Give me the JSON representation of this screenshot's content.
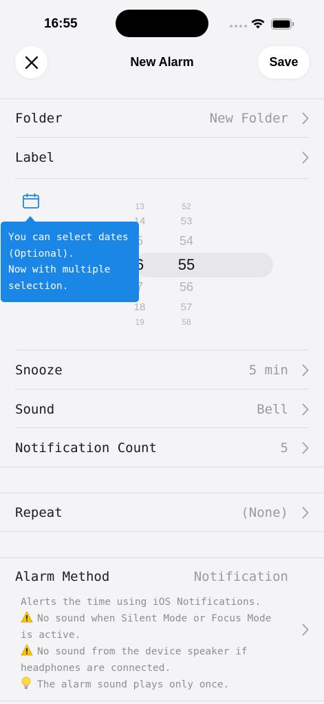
{
  "status_bar": {
    "time": "16:55"
  },
  "nav": {
    "title": "New Alarm",
    "save_label": "Save",
    "close_icon": "close-icon"
  },
  "rows": {
    "folder": {
      "label": "Folder",
      "value": "New Folder"
    },
    "label": {
      "label": "Label"
    },
    "snooze": {
      "label": "Snooze",
      "value": "5 min"
    },
    "sound": {
      "label": "Sound",
      "value": "Bell"
    },
    "notification_count": {
      "label": "Notification Count",
      "value": "5"
    },
    "repeat": {
      "label": "Repeat",
      "value": "(None)"
    }
  },
  "picker": {
    "hours": [
      "13",
      "14",
      "5",
      "6",
      "7",
      "18",
      "19"
    ],
    "minutes": [
      "52",
      "53",
      "54",
      "55",
      "56",
      "57",
      "58"
    ],
    "selected_hour": "6",
    "selected_minute": "55"
  },
  "tooltip": {
    "lines": [
      "You can select dates",
      "(Optional).",
      "Now with multiple",
      "selection."
    ]
  },
  "alarm_method": {
    "label": "Alarm Method",
    "value": "Notification",
    "desc_line1": "Alerts the time using iOS Notifications.",
    "warn1_line1": "No sound when Silent Mode or Focus Mode",
    "warn1_line2": "is active.",
    "warn2_line1": "No sound from the device speaker if",
    "warn2_line2": "headphones are connected.",
    "tip_line": "The alarm sound plays only once."
  },
  "colors": {
    "accent": "#1a86e6",
    "background": "#f4f4f6",
    "secondary_text": "#9a9a9e"
  }
}
